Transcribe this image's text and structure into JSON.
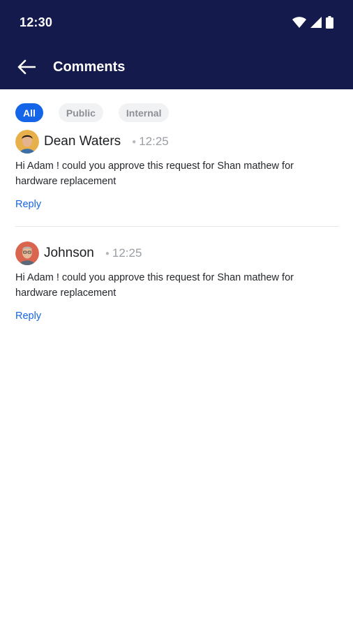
{
  "status_bar": {
    "time": "12:30"
  },
  "app_bar": {
    "title": "Comments"
  },
  "filters": [
    {
      "label": "All",
      "active": true
    },
    {
      "label": "Public",
      "active": false
    },
    {
      "label": "Internal",
      "active": false
    }
  ],
  "comments": [
    {
      "author": "Dean Waters",
      "time": "12:25",
      "text": "Hi Adam ! could you approve this request for Shan mathew for hardware replacement",
      "reply_label": "Reply"
    },
    {
      "author": "Johnson",
      "time": "12:25",
      "text": "Hi Adam ! could you approve this request for Shan mathew for hardware replacement",
      "reply_label": "Reply"
    }
  ],
  "colors": {
    "header": "#141a4b",
    "accent": "#1565e8"
  }
}
